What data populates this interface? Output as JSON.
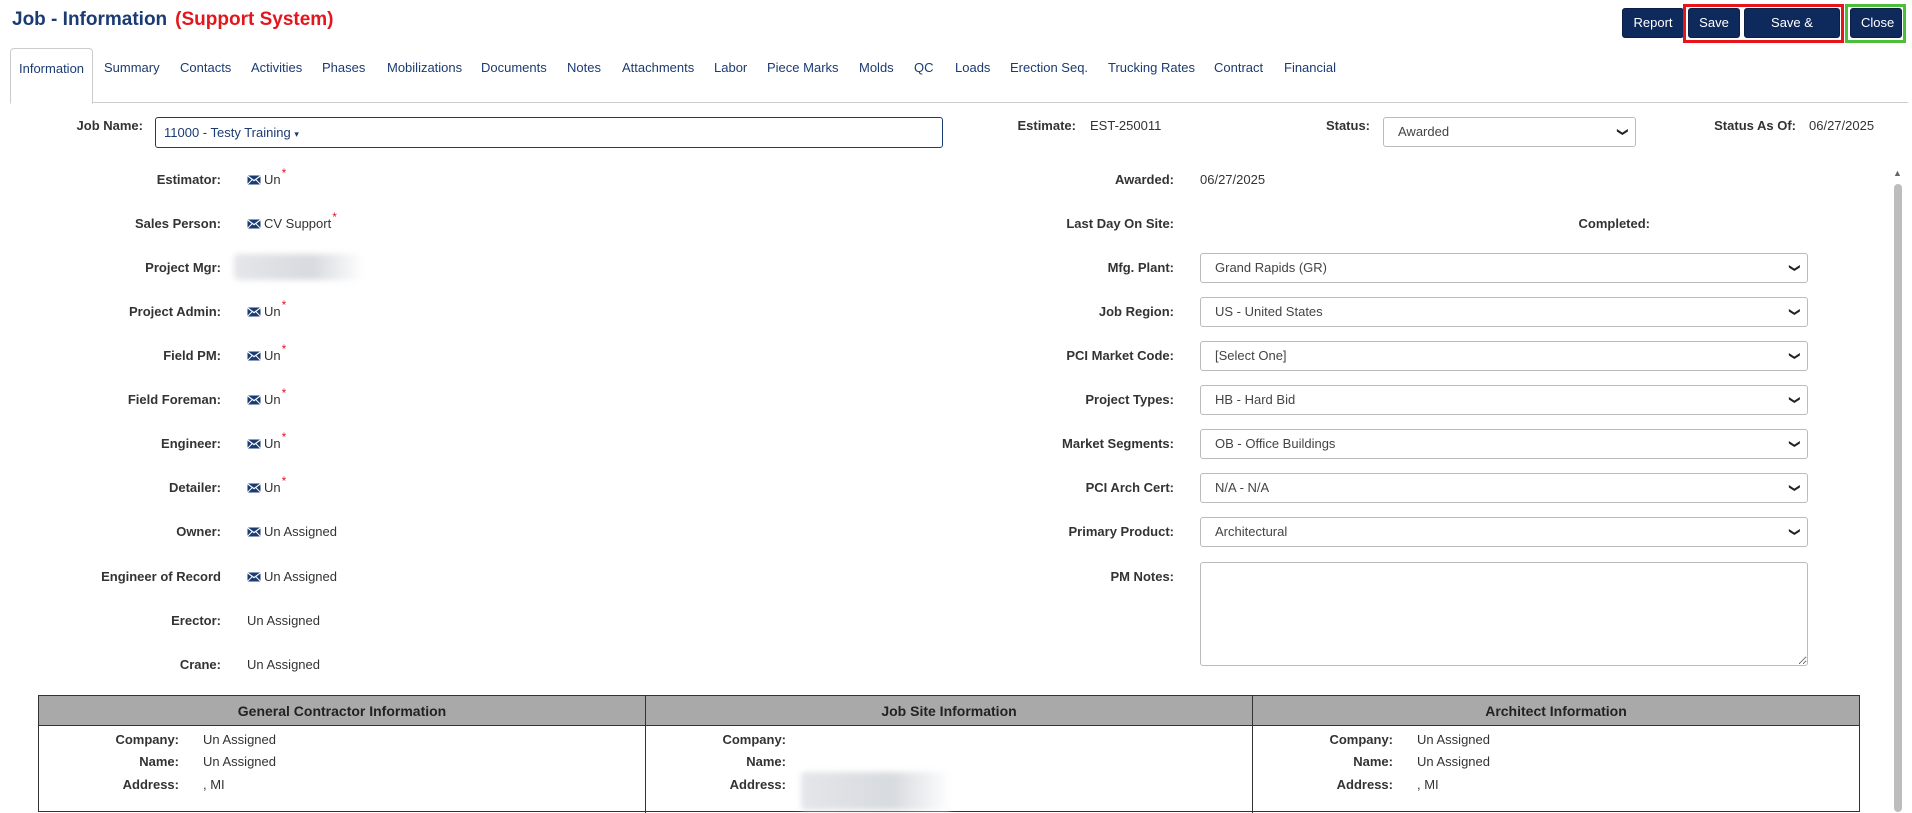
{
  "header": {
    "title": "Job - Information",
    "system": "(Support System)",
    "buttons": {
      "report": "Report",
      "save": "Save",
      "save_close": "Save & Close",
      "close": "Close"
    }
  },
  "tabs": [
    "Information",
    "Summary",
    "Contacts",
    "Activities",
    "Phases",
    "Mobilizations",
    "Documents",
    "Notes",
    "Attachments",
    "Labor",
    "Piece Marks",
    "Molds",
    "QC",
    "Loads",
    "Erection Seq.",
    "Trucking Rates",
    "Contract",
    "Financial"
  ],
  "top_fields": {
    "job_name_label": "Job Name:",
    "job_name_value": "11000 - Testy Training",
    "estimate_label": "Estimate:",
    "estimate_value": "EST-250011",
    "status_label": "Status:",
    "status_value": "Awarded",
    "status_as_of_label": "Status As Of:",
    "status_as_of_value": "06/27/2025"
  },
  "left_fields": [
    {
      "label": "Estimator:",
      "value": "Un",
      "mail": true,
      "required": true
    },
    {
      "label": "Sales Person:",
      "value": "CV Support",
      "mail": true,
      "required": true
    },
    {
      "label": "Project Mgr:",
      "value": "",
      "mail": false,
      "required": false
    },
    {
      "label": "Project Admin:",
      "value": "Un",
      "mail": true,
      "required": true
    },
    {
      "label": "Field PM:",
      "value": "Un",
      "mail": true,
      "required": true
    },
    {
      "label": "Field Foreman:",
      "value": "Un",
      "mail": true,
      "required": true
    },
    {
      "label": "Engineer:",
      "value": "Un",
      "mail": true,
      "required": true
    },
    {
      "label": "Detailer:",
      "value": "Un",
      "mail": true,
      "required": true
    },
    {
      "label": "Owner:",
      "value": "Un Assigned",
      "mail": true,
      "required": false
    },
    {
      "label": "Engineer of Record",
      "value": "Un Assigned",
      "mail": true,
      "required": false
    },
    {
      "label": "Erector:",
      "value": "Un Assigned",
      "mail": false,
      "required": false
    },
    {
      "label": "Crane:",
      "value": "Un Assigned",
      "mail": false,
      "required": false
    }
  ],
  "right_fields": {
    "awarded_label": "Awarded:",
    "awarded_value": "06/27/2025",
    "last_day_label": "Last Day On Site:",
    "completed_label": "Completed:",
    "selects": [
      {
        "label": "Mfg. Plant:",
        "value": "Grand Rapids (GR)"
      },
      {
        "label": "Job Region:",
        "value": "US - United States"
      },
      {
        "label": "PCI Market Code:",
        "value": "[Select One]"
      },
      {
        "label": "Project Types:",
        "value": "HB - Hard Bid"
      },
      {
        "label": "Market Segments:",
        "value": "OB - Office Buildings"
      },
      {
        "label": "PCI Arch Cert:",
        "value": "N/A - N/A"
      },
      {
        "label": "Primary Product:",
        "value": "Architectural"
      }
    ],
    "pm_notes_label": "PM Notes:"
  },
  "info_sections": [
    {
      "title": "General Contractor Information",
      "company": "Un Assigned",
      "name": "Un Assigned",
      "address": ", MI"
    },
    {
      "title": "Job Site Information",
      "company": "",
      "name": "",
      "address": ""
    },
    {
      "title": "Architect Information",
      "company": "Un Assigned",
      "name": "Un Assigned",
      "address": ", MI"
    }
  ],
  "info_labels": {
    "company": "Company:",
    "name": "Name:",
    "address": "Address:"
  },
  "colors": {
    "brand_navy": "#0e2a5c",
    "link_blue": "#1b3b73",
    "required_red": "#e3161d",
    "highlight_red": "#e8141c",
    "highlight_green": "#4cbe3a"
  }
}
